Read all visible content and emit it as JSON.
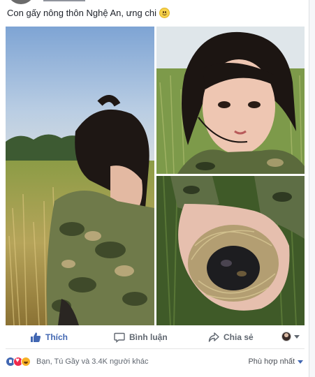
{
  "post": {
    "caption": "Con gấy nông thôn Nghệ An, ưng chi",
    "caption_emoji": "smiley-icon"
  },
  "photos": [
    {
      "subject": "girl-in-rice-field"
    },
    {
      "subject": "girl-face-closeup"
    },
    {
      "subject": "hands-holding-nest"
    }
  ],
  "actions": {
    "like_label": "Thích",
    "comment_label": "Bình luận",
    "share_label": "Chia sẻ"
  },
  "reactions": {
    "types": [
      "like",
      "love",
      "haha"
    ],
    "summary": "Bạn, Tú Gầy và 3.4K người khác"
  },
  "sort": {
    "label": "Phù hợp nhất"
  },
  "colors": {
    "brand": "#4267b2",
    "text": "#1d2129",
    "muted": "#606770"
  }
}
